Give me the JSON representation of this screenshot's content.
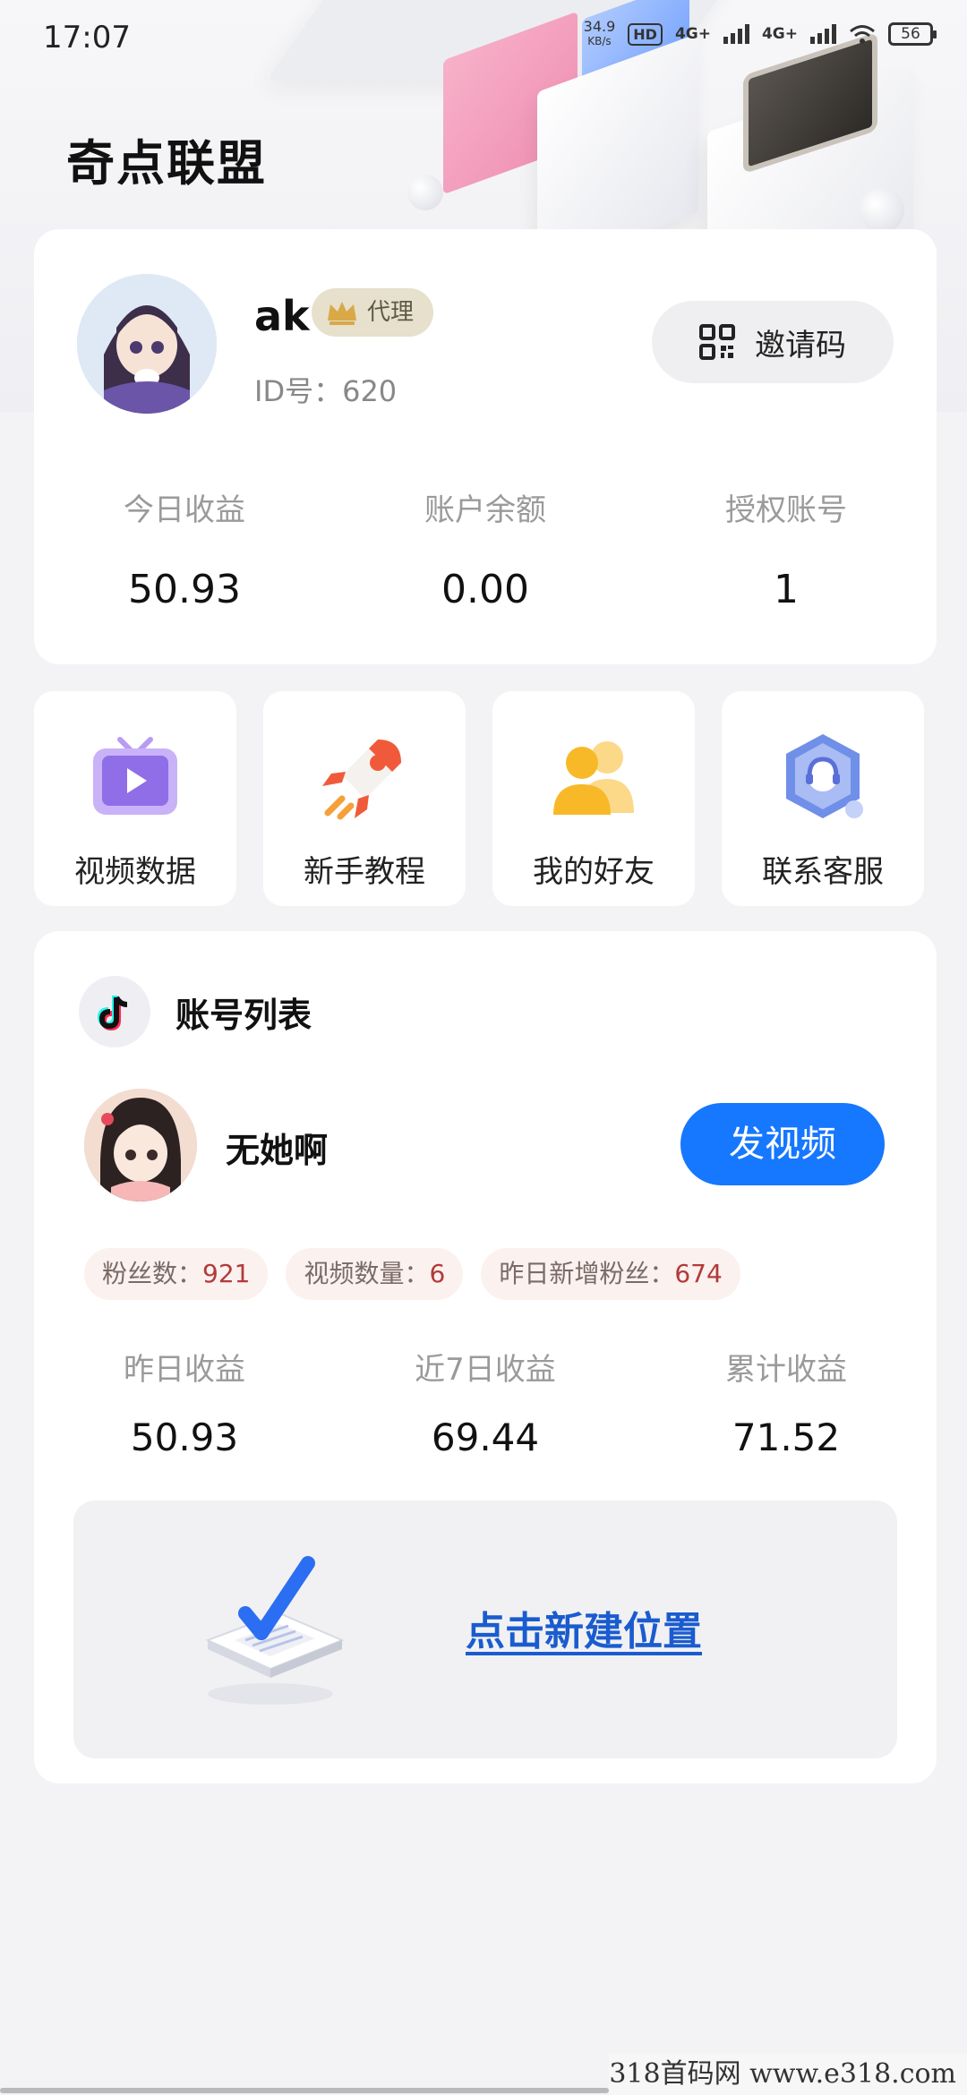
{
  "status_bar": {
    "time": "17:07",
    "net_speed_value": "34.9",
    "net_speed_unit": "KB/s",
    "hd_label": "HD",
    "sim1_net": "4G+",
    "sim2_net": "4G+",
    "battery": "56"
  },
  "header": {
    "app_title": "奇点联盟"
  },
  "profile": {
    "username": "ak",
    "badge": "代理",
    "id_label": "ID号：620",
    "invite_label": "邀请码",
    "stats": [
      {
        "label": "今日收益",
        "value": "50.93"
      },
      {
        "label": "账户余额",
        "value": "0.00"
      },
      {
        "label": "授权账号",
        "value": "1"
      }
    ]
  },
  "features": [
    {
      "label": "视频数据",
      "icon": "tv-play-icon"
    },
    {
      "label": "新手教程",
      "icon": "rocket-icon"
    },
    {
      "label": "我的好友",
      "icon": "friends-icon"
    },
    {
      "label": "联系客服",
      "icon": "customer-service-icon"
    }
  ],
  "account_list": {
    "title": "账号列表",
    "account": {
      "name": "无她啊",
      "post_button": "发视频",
      "tags": [
        {
          "label": "粉丝数：",
          "value": "921"
        },
        {
          "label": "视频数量：",
          "value": "6"
        },
        {
          "label": "昨日新增粉丝：",
          "value": "674"
        }
      ],
      "stats": [
        {
          "label": "昨日收益",
          "value": "50.93"
        },
        {
          "label": "近7日收益",
          "value": "69.44"
        },
        {
          "label": "累计收益",
          "value": "71.52"
        }
      ]
    },
    "new_location_link": "点击新建位置"
  },
  "watermark": "318首码网 www.e318.com",
  "colors": {
    "primary": "#1677ff",
    "link": "#1a5ccf",
    "tag_value": "#b23a3a"
  }
}
